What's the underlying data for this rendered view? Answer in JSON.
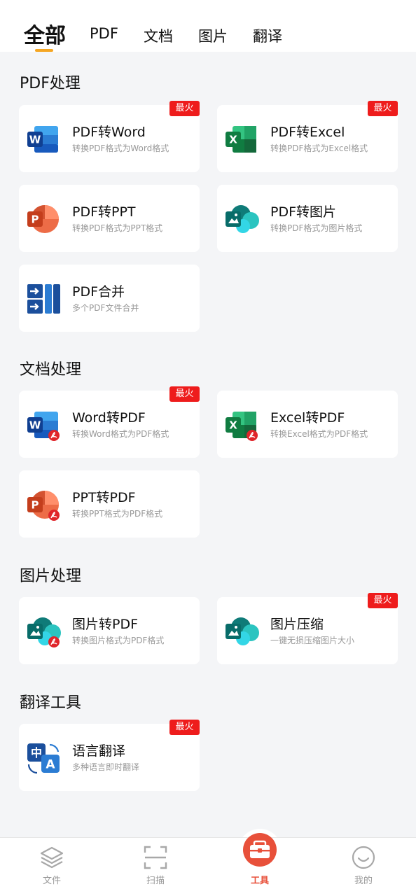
{
  "tabs": [
    {
      "label": "全部",
      "active": true
    },
    {
      "label": "PDF"
    },
    {
      "label": "文档"
    },
    {
      "label": "图片"
    },
    {
      "label": "翻译"
    }
  ],
  "sections": [
    {
      "title": "PDF处理",
      "cards": [
        {
          "title": "PDF转Word",
          "subtitle": "转换PDF格式为Word格式",
          "badge": "最火",
          "icon": "word-icon"
        },
        {
          "title": "PDF转Excel",
          "subtitle": "转换PDF格式为Excel格式",
          "badge": "最火",
          "icon": "excel-icon"
        },
        {
          "title": "PDF转PPT",
          "subtitle": "转换PDF格式为PPT格式",
          "icon": "ppt-icon"
        },
        {
          "title": "PDF转图片",
          "subtitle": "转换PDF格式为图片格式",
          "icon": "image-icon"
        },
        {
          "title": "PDF合并",
          "subtitle": "多个PDF文件合并",
          "icon": "merge-icon"
        }
      ]
    },
    {
      "title": "文档处理",
      "cards": [
        {
          "title": "Word转PDF",
          "subtitle": "转换Word格式为PDF格式",
          "badge": "最火",
          "icon": "word-to-pdf-icon"
        },
        {
          "title": "Excel转PDF",
          "subtitle": "转换Excel格式为PDF格式",
          "icon": "excel-to-pdf-icon"
        },
        {
          "title": "PPT转PDF",
          "subtitle": "转换PPT格式为PDF格式",
          "icon": "ppt-to-pdf-icon"
        }
      ]
    },
    {
      "title": "图片处理",
      "cards": [
        {
          "title": "图片转PDF",
          "subtitle": "转换图片格式为PDF格式",
          "icon": "image-to-pdf-icon"
        },
        {
          "title": "图片压缩",
          "subtitle": "一键无损压缩图片大小",
          "badge": "最火",
          "icon": "image-compress-icon"
        }
      ]
    },
    {
      "title": "翻译工具",
      "cards": [
        {
          "title": "语言翻译",
          "subtitle": "多种语言即时翻译",
          "badge": "最火",
          "icon": "translate-icon"
        }
      ]
    }
  ],
  "bottom_nav": [
    {
      "label": "文件",
      "icon": "layers-icon"
    },
    {
      "label": "扫描",
      "icon": "scan-icon"
    },
    {
      "label": "工具",
      "icon": "toolbox-icon",
      "active": true
    },
    {
      "label": "我的",
      "icon": "smile-icon"
    }
  ],
  "colors": {
    "accent": "#f5a623",
    "badge": "#ee1c1c",
    "active_nav": "#e8503a",
    "word": "#185abd",
    "excel": "#21a366",
    "ppt": "#d35230",
    "image": "#0f7b78",
    "pdf": "#e0252a"
  }
}
